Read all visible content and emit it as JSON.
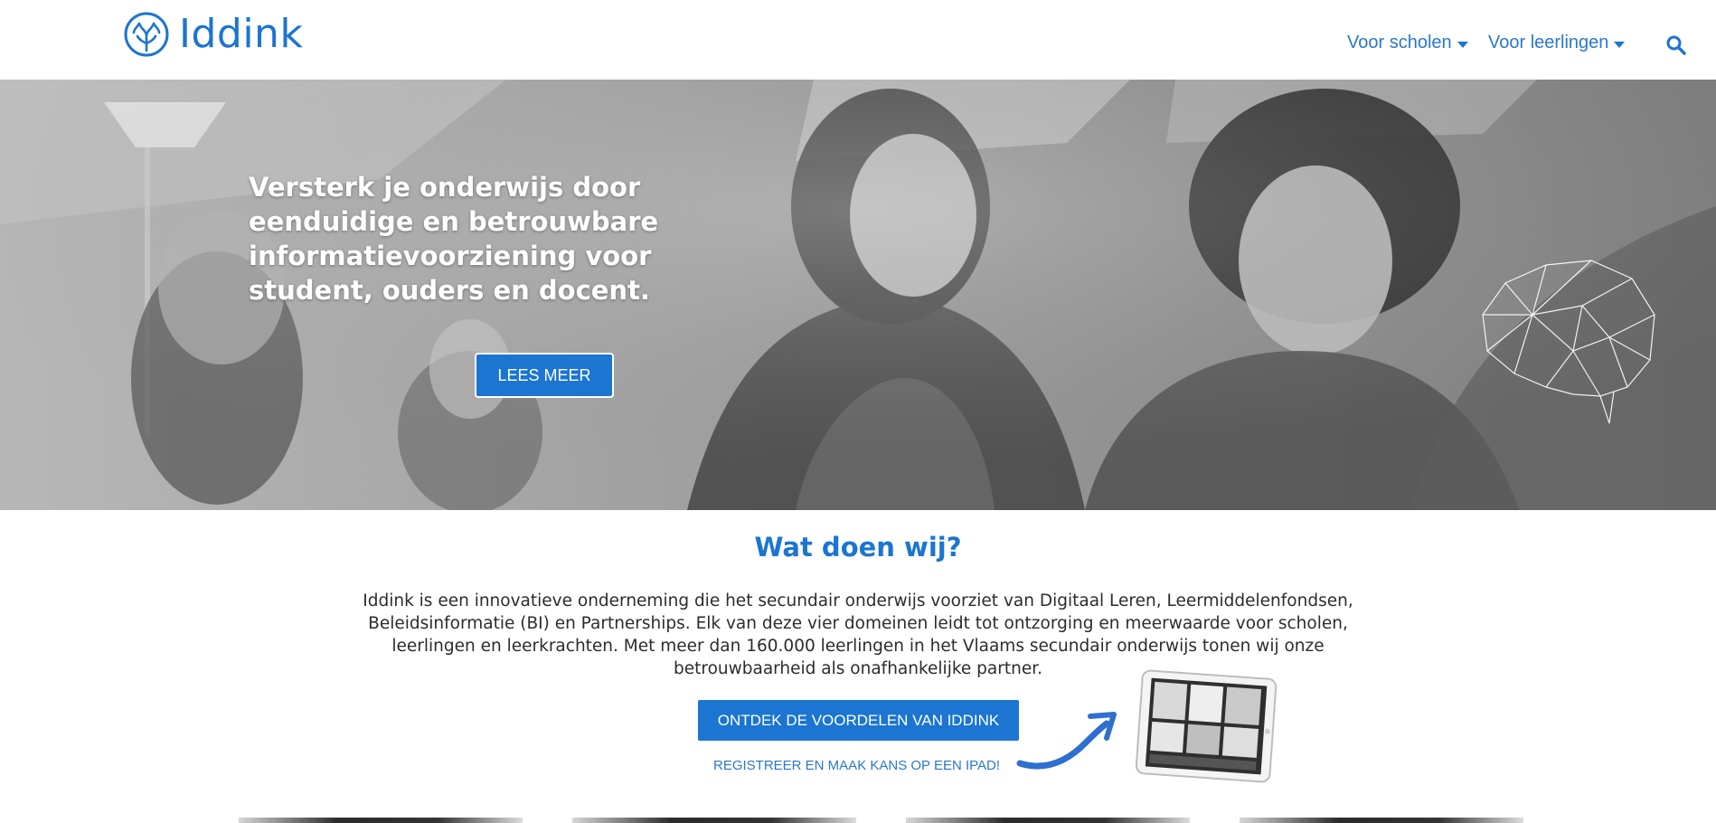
{
  "header": {
    "logo_text": "Iddink",
    "nav": [
      {
        "label": "Voor scholen"
      },
      {
        "label": "Voor leerlingen"
      }
    ],
    "search_icon": "search-icon"
  },
  "hero": {
    "title": "Versterk je onderwijs door eenduidige en betrouwbare informatievoorziening voor student, ouders en docent.",
    "button_label": "LEES MEER"
  },
  "main": {
    "section_title": "Wat doen wij?",
    "intro": "Iddink is een innovatieve onderneming die het secundair onderwijs voorziet van Digitaal Leren, Leermiddelenfondsen, Beleidsinformatie (BI) en Partnerships. Elk van deze vier domeinen leidt tot ontzorging en meerwaarde voor scholen, leerlingen en leerkrachten. Met meer dan 160.000 leerlingen in het Vlaams secundair onderwijs tonen wij onze betrouwbaarheid als onafhankelijke partner.",
    "cta_label": "ONTDEK DE VOORDELEN VAN IDDINK",
    "register_label": "REGISTREER EN MAAK KANS OP EEN IPAD!"
  },
  "colors": {
    "brand_blue": "#1b75d1",
    "text_dark": "#2c2c2c"
  }
}
